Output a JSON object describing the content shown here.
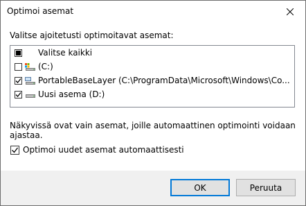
{
  "window": {
    "title": "Optimoi asemat",
    "close_icon": "close-icon"
  },
  "prompt": "Valitse ajoitetusti optimoitavat asemat:",
  "drives": {
    "select_all": {
      "label": "Valitse kaikki",
      "state": "indeterminate"
    },
    "items": [
      {
        "label": "(C:)",
        "checked": false,
        "icon": "system-drive-icon"
      },
      {
        "label": "PortableBaseLayer (C:\\ProgramData\\Microsoft\\Windows\\Co...",
        "checked": true,
        "icon": "mounted-drive-icon"
      },
      {
        "label": "Uusi asema (D:)",
        "checked": true,
        "icon": "drive-icon"
      }
    ]
  },
  "note": "Näkyvissä ovat vain asemat, joille automaattinen optimointi voidaan ajastaa.",
  "auto_option": {
    "label": "Optimoi uudet asemat automaattisesti",
    "checked": true
  },
  "buttons": {
    "ok": "OK",
    "cancel": "Peruuta"
  },
  "colors": {
    "accent": "#0078d7",
    "footer": "#f0f0f0"
  }
}
